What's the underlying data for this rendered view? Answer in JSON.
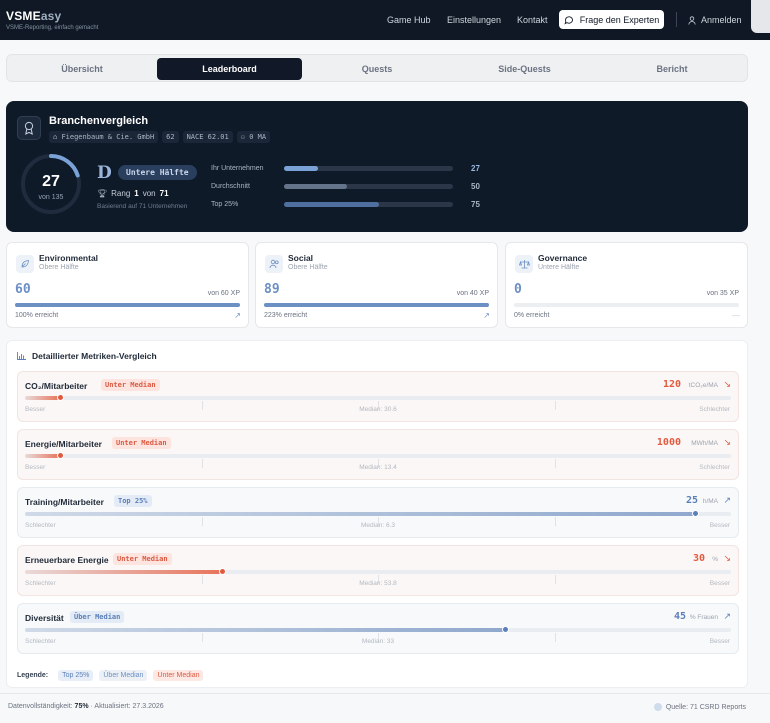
{
  "header": {
    "brand_main": "VSME",
    "brand_accent": "asy",
    "brand_sub": "VSME-Reporting, einfach gemacht",
    "nav": [
      "Game Hub",
      "Einstellungen",
      "Kontakt"
    ],
    "expert_button": "Frage den Experten",
    "login": "Anmelden"
  },
  "tabs": [
    "Übersicht",
    "Leaderboard",
    "Quests",
    "Side-Quests",
    "Bericht"
  ],
  "active_tab": "Leaderboard",
  "hero": {
    "title": "Branchenvergleich",
    "company": "Fiegenbaum & Cie. GmbH",
    "code": "62",
    "nace": "NACE 62.01",
    "employees": "0 MA",
    "score": "27",
    "score_of": "von 135",
    "score_fraction": 0.2,
    "grade": "D",
    "grade_label": "Untere Hälfte",
    "rank_prefix": "Rang",
    "rank": "1",
    "rank_mid": "von",
    "rank_total": "71",
    "based_on": "Basierend auf 71 Unternehmen",
    "comparison": [
      {
        "label": "Ihr Unternehmen",
        "value": "27",
        "fraction": 0.2,
        "color": "#7aa2d6"
      },
      {
        "label": "Durchschnitt",
        "value": "50",
        "fraction": 0.37,
        "color": "#64748b"
      },
      {
        "label": "Top 25%",
        "value": "75",
        "fraction": 0.56,
        "color": "#4f6f9f"
      }
    ]
  },
  "esg": [
    {
      "name": "Environmental",
      "sub": "Obere Hälfte",
      "value": "60",
      "xp": "von 60 XP",
      "fraction": 1.0,
      "pct": "100% erreicht",
      "trend": "↗"
    },
    {
      "name": "Social",
      "sub": "Obere Hälfte",
      "value": "89",
      "xp": "von 40 XP",
      "fraction": 1.0,
      "pct": "223% erreicht",
      "trend": "↗"
    },
    {
      "name": "Governance",
      "sub": "Untere Hälfte",
      "value": "0",
      "xp": "von 35 XP",
      "fraction": 0.0,
      "pct": "0% erreicht",
      "trend": "—"
    }
  ],
  "metrics": {
    "title": "Detaillierter Metriken-Vergleich",
    "rows": [
      {
        "name": "CO₂/Mitarbeiter",
        "status": "Unter Median",
        "tone": "bad",
        "value": "120",
        "unit": "tCO₂e/MA",
        "fraction": 0.05,
        "left": "Besser",
        "mid": "Median: 30.6",
        "right": "Schlechter",
        "trend": "↘"
      },
      {
        "name": "Energie/Mitarbeiter",
        "status": "Unter Median",
        "tone": "bad",
        "value": "1000",
        "unit": "MWh/MA",
        "fraction": 0.05,
        "left": "Besser",
        "mid": "Median: 13.4",
        "right": "Schlechter",
        "trend": "↘"
      },
      {
        "name": "Training/Mitarbeiter",
        "status": "Top 25%",
        "tone": "good",
        "value": "25",
        "unit": "h/MA",
        "fraction": 0.95,
        "left": "Schlechter",
        "mid": "Median: 6.3",
        "right": "Besser",
        "trend": "↗"
      },
      {
        "name": "Erneuerbare Energie",
        "status": "Unter Median",
        "tone": "bad",
        "value": "30",
        "unit": "%",
        "fraction": 0.28,
        "left": "Schlechter",
        "mid": "Median: 53.8",
        "right": "Besser",
        "trend": "↘"
      },
      {
        "name": "Diversität",
        "status": "Über Median",
        "tone": "good",
        "value": "45",
        "unit": "% Frauen",
        "fraction": 0.68,
        "left": "Schlechter",
        "mid": "Median: 33",
        "right": "Besser",
        "trend": "↗"
      }
    ],
    "legend_label": "Legende:",
    "legend": [
      "Top 25%",
      "Über Median",
      "Unter Median"
    ]
  },
  "footer": {
    "completeness_label": "Datenvollständigkeit:",
    "completeness": "75%",
    "updated": "· Aktualisiert: 27.3.2026",
    "source": "Quelle: 71 CSRD Reports"
  },
  "colors": {
    "bad": "#e15a3e",
    "good": "#5b7fb8",
    "ring": "#7aa2d6",
    "dark": "#0f1824"
  }
}
